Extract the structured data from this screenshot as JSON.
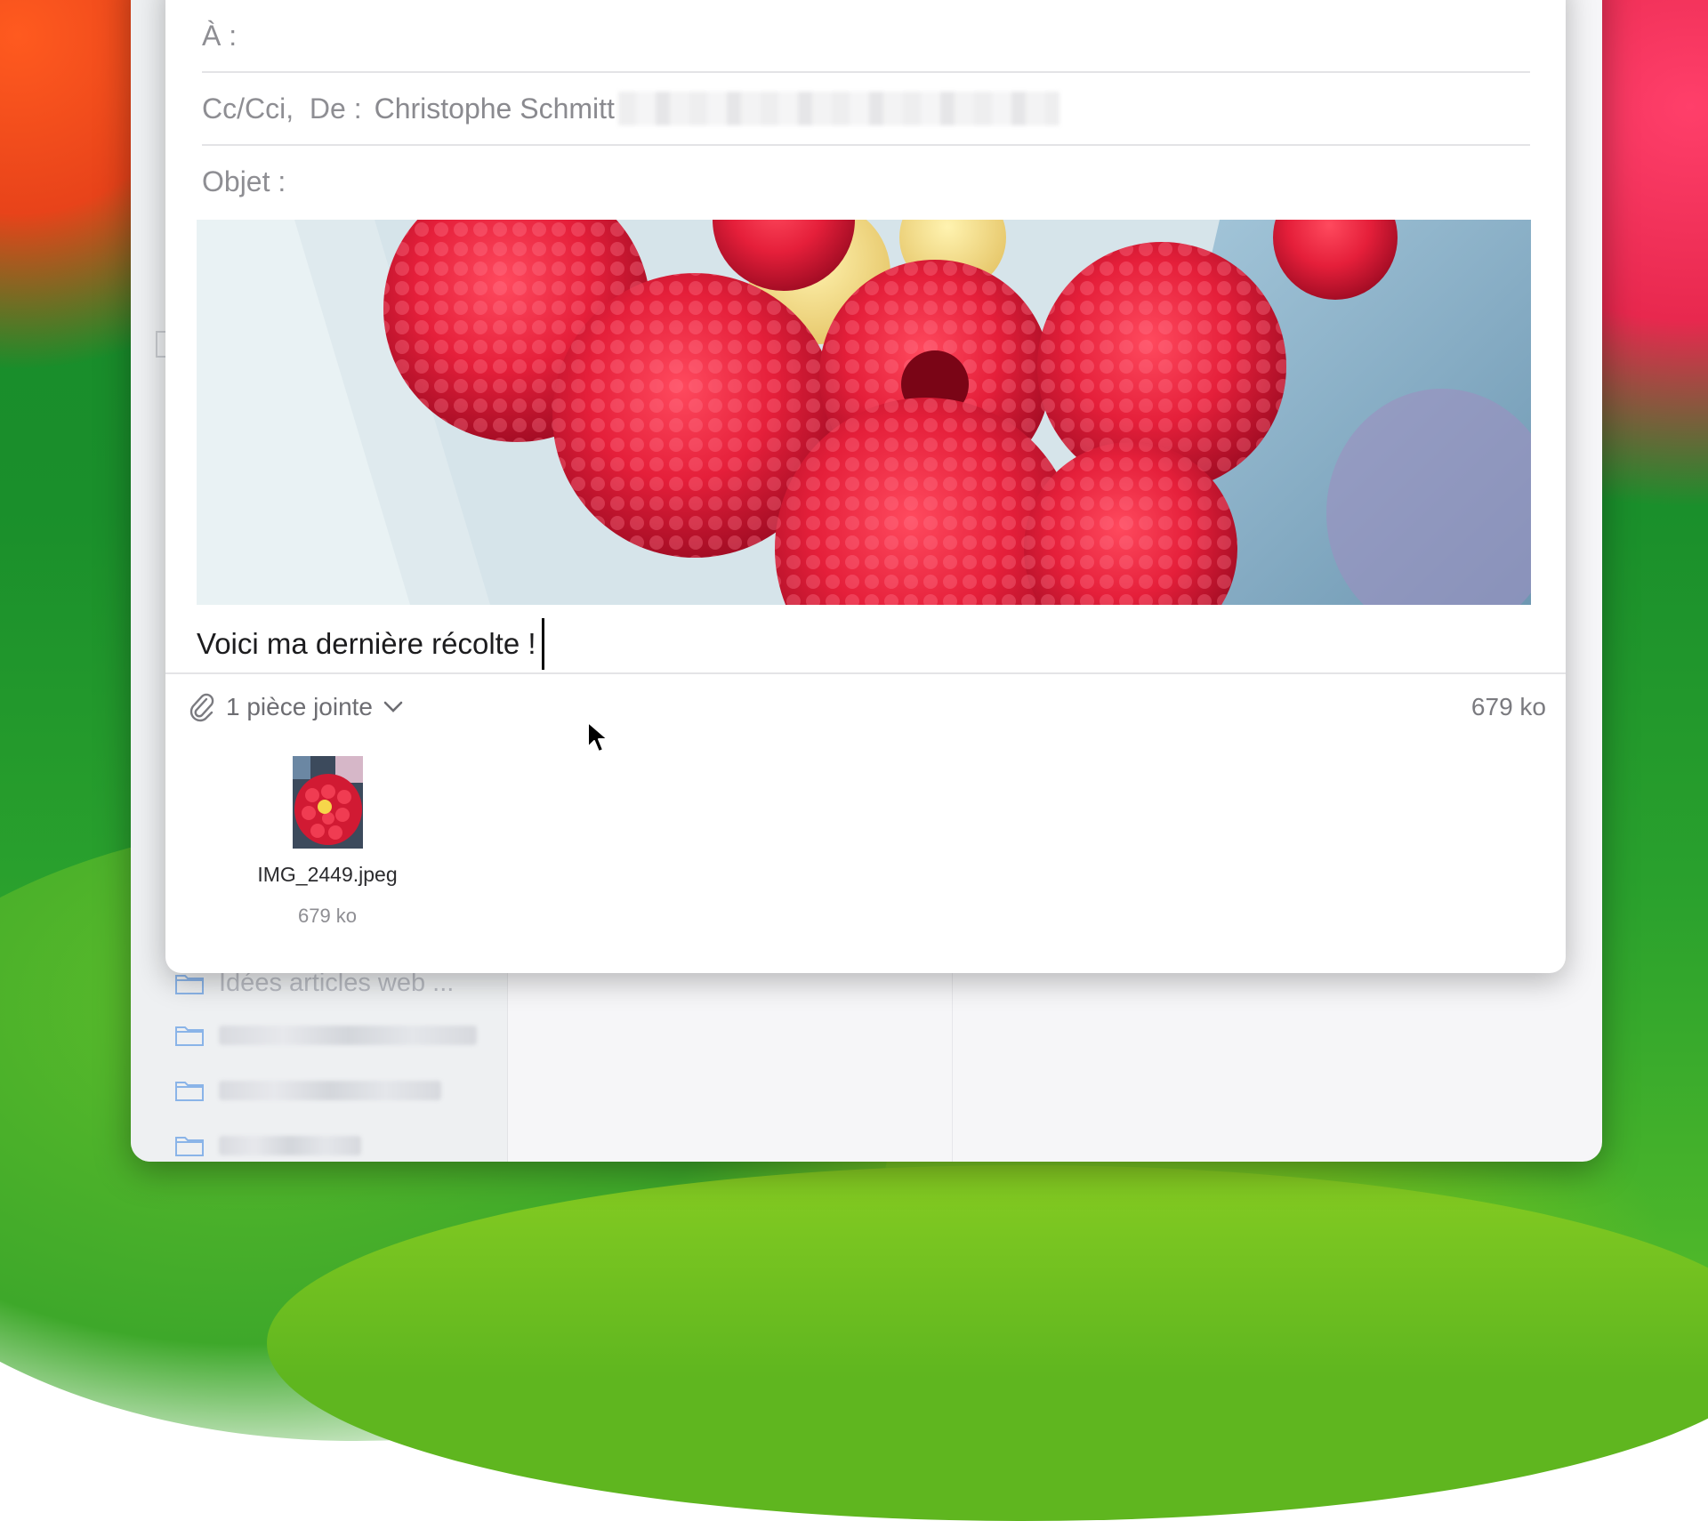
{
  "compose": {
    "to_label": "À :",
    "ccfrom_label": "Cc/Cci,  De :",
    "from_name": "Christophe Schmitt",
    "subject_label": "Objet :",
    "body_text": "Voici ma dernière récolte !"
  },
  "attachments": {
    "summary_label": "1 pièce jointe",
    "total_size": "679 ko",
    "items": [
      {
        "name": "IMG_2449.jpeg",
        "size": "679 ko"
      }
    ]
  },
  "background_window": {
    "folders": [
      {
        "label": "Idées articles web ..."
      }
    ]
  },
  "icons": [
    "paperclip-icon",
    "chevron-down-icon",
    "folder-icon",
    "mouse-pointer-icon"
  ]
}
